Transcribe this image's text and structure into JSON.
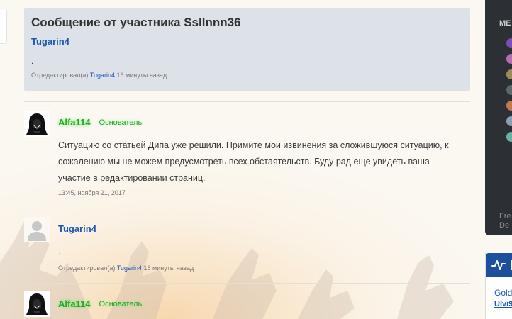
{
  "quote": {
    "title": "Сообщение от участника Ssllnnn36",
    "author": "Tugarin4",
    "body": ".",
    "edited_prefix": "Отредактировал(а)",
    "edited_user": "Tugarin4",
    "edited_time": "16 минуты назад"
  },
  "posts": [
    {
      "author": "Alfa114",
      "role": "Основатель",
      "text": "Ситуацию со статьей Дипа уже решили. Примите мои извинения за сложившуюся ситуацию, к сожалению мы не можем предусмотреть всех обстаятельств. Буду рад еще увидеть ваша участие в редактировании страниц.",
      "timestamp": "13:45, ноября 21, 2017"
    },
    {
      "author": "Tugarin4",
      "text": ".",
      "edited_prefix": "Отредактировал(а)",
      "edited_user": "Tugarin4",
      "edited_time": "16 минуты назад"
    },
    {
      "author": "Alfa114",
      "role": "Основатель"
    }
  ],
  "sidebar": {
    "heading_fragment": "МЕ",
    "footer_fragment_1": "Fre",
    "footer_fragment_2": "De"
  },
  "widget": {
    "icon": "activity-icon",
    "line1": "Gold",
    "line2": "Ulvi9"
  },
  "colors": {
    "link": "#1b57b8",
    "founder_green": "#2aa52a",
    "quote_bg": "#dde2e9",
    "widget_head": "#1c4f9c",
    "sidebar_dark": "#2c2f34"
  }
}
